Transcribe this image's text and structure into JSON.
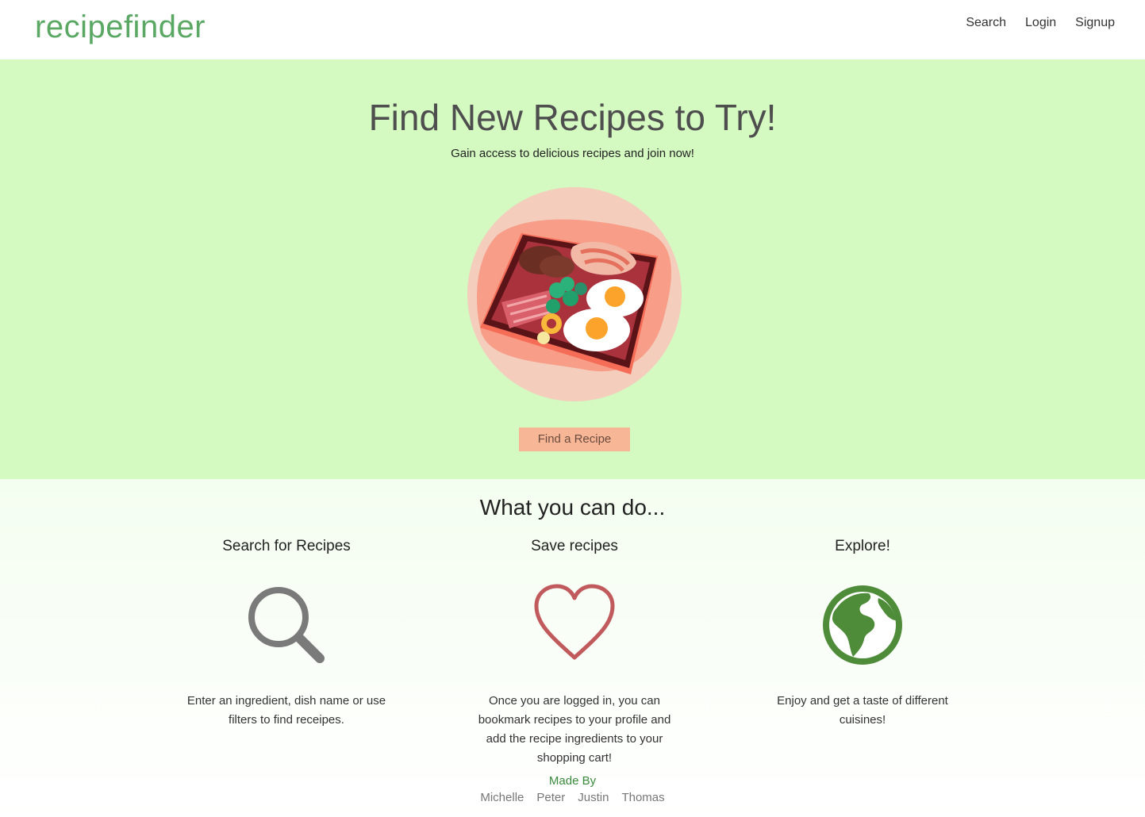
{
  "nav": {
    "brand": "recipefinder",
    "links": [
      "Search",
      "Login",
      "Signup"
    ]
  },
  "hero": {
    "title": "Find New Recipes to Try!",
    "subtitle": "Gain access to delicious recipes and join now!",
    "button_label": "Find a Recipe"
  },
  "features": {
    "title": "What you can do...",
    "items": [
      {
        "title": "Search for Recipes",
        "icon": "magnifier-icon",
        "text": "Enter an ingredient, dish name or use filters to find receipes."
      },
      {
        "title": "Save recipes",
        "icon": "heart-icon",
        "text": "Once you are logged in, you can bookmark recipes to your profile and add the recipe ingredients to your shopping cart!"
      },
      {
        "title": "Explore!",
        "icon": "globe-icon",
        "text": "Enjoy and get a taste of different cuisines!"
      }
    ]
  },
  "footer": {
    "made_by": "Made By",
    "authors": [
      "Michelle",
      "Peter",
      "Justin",
      "Thomas"
    ]
  },
  "colors": {
    "brand": "#5aa864",
    "hero_bg": "#d4f9c1",
    "button_bg": "#f7b796",
    "heart": "#c05a5c",
    "globe": "#4f8c3a",
    "magnifier": "#7a7a7a"
  }
}
